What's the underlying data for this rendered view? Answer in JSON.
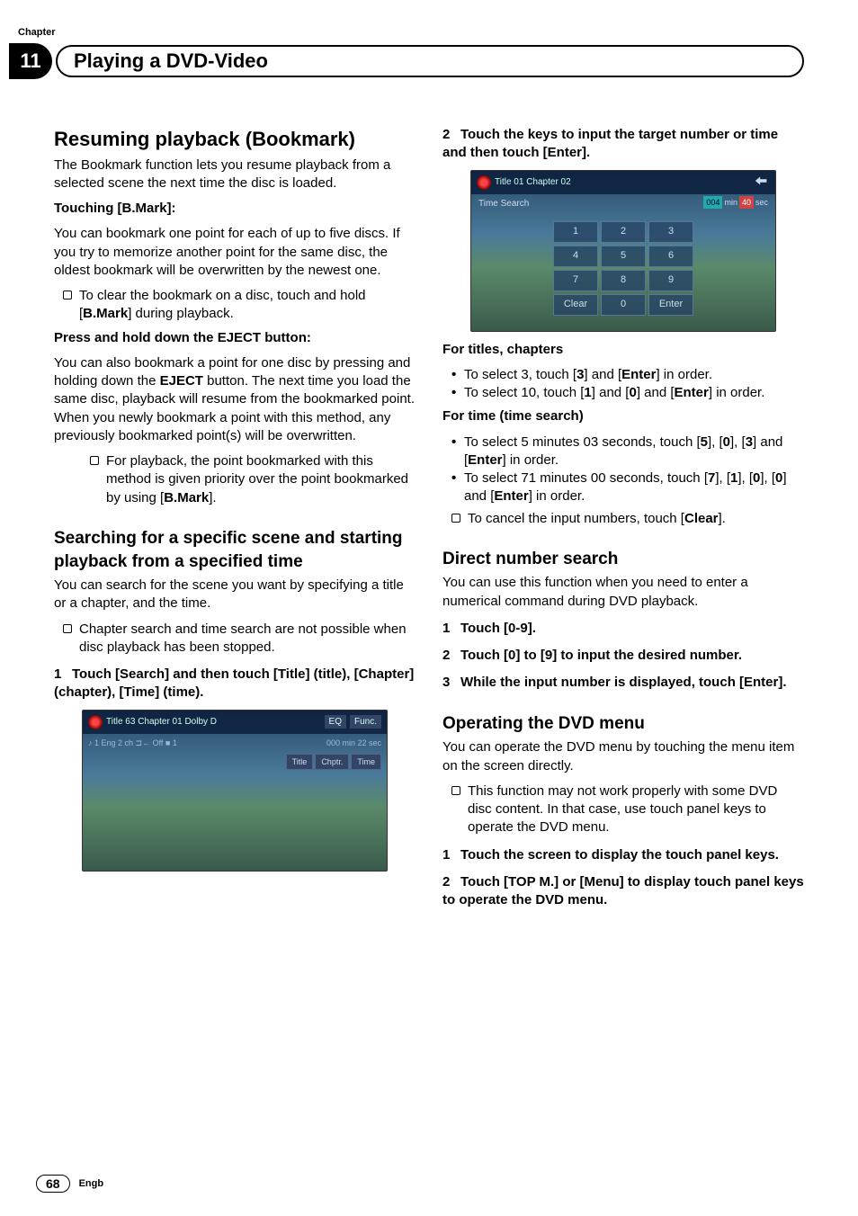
{
  "header": {
    "chapter_label": "Chapter",
    "chapter_number": "11",
    "title": "Playing a DVD-Video"
  },
  "left": {
    "h_resume": "Resuming playback (Bookmark)",
    "resume_intro": "The Bookmark function lets you resume playback from a selected scene the next time the disc is loaded.",
    "touching_bmark_label": "Touching [B.Mark]:",
    "touching_bmark_body": "You can bookmark one point for each of up to five discs. If you try to memorize another point for the same disc, the oldest bookmark will be overwritten by the newest one.",
    "touching_bmark_bullet_pre": "To clear the bookmark on a disc, touch and hold [",
    "touching_bmark_bullet_bold": "B.Mark",
    "touching_bmark_bullet_post": "] during playback.",
    "press_hold_label_pre": "Press and hold down the ",
    "press_hold_label_bold": "EJECT",
    "press_hold_label_post": " button:",
    "press_hold_body_pre": "You can also bookmark a point for one disc by pressing and holding down the ",
    "press_hold_body_bold": "EJECT",
    "press_hold_body_post": " button. The next time you load the same disc, playback will resume from the bookmarked point. When you newly bookmark a point with this method, any previously bookmarked point(s) will be overwritten.",
    "press_hold_bullet_pre": "For playback, the point bookmarked with this method is given priority over the point bookmarked by using [",
    "press_hold_bullet_bold": "B.Mark",
    "press_hold_bullet_post": "].",
    "h_search": "Searching for a specific scene and starting playback from a specified time",
    "search_intro": "You can search for the scene you want by specifying a title or a chapter, and the time.",
    "search_bullet": "Chapter search and time search are not possible when disc playback has been stopped.",
    "search_step1": "Touch [Search] and then touch [Title] (title), [Chapter] (chapter), [Time] (time).",
    "ss1": {
      "topline": "Title  63    Chapter 01        Dolby D",
      "line2_left": "♪ 1 Eng     2 ch   ⊐← Off      ■ 1",
      "eq": "EQ",
      "func": "Func.",
      "time": "000 min 22 sec",
      "btn_title": "Title",
      "btn_chptr": "Chptr.",
      "btn_time": "Time"
    }
  },
  "right": {
    "step2": "Touch the keys to input the target number or time and then touch [Enter].",
    "ss2": {
      "topline": "Title  01    Chapter 02",
      "time_search": "Time Search",
      "tb_min_val": "004",
      "tb_min_lbl": "min",
      "tb_sec_val": "40",
      "tb_sec_lbl": "sec",
      "k1": "1",
      "k2": "2",
      "k3": "3",
      "k4": "4",
      "k5": "5",
      "k6": "6",
      "k7": "7",
      "k8": "8",
      "k9": "9",
      "kclear": "Clear",
      "k0": "0",
      "kenter": "Enter"
    },
    "for_titles_label": "For titles, chapters",
    "titles_b1_pre": "To select 3, touch [",
    "titles_b1_m1": "3",
    "titles_b1_mid": "] and [",
    "titles_b1_m2": "Enter",
    "titles_b1_post": "] in order.",
    "titles_b2_pre": "To select 10, touch [",
    "titles_b2_m1": "1",
    "titles_b2_mid": "] and [",
    "titles_b2_m2": "0",
    "titles_b2_mid2": "] and [",
    "titles_b2_m3": "Enter",
    "titles_b2_post": "] in order.",
    "for_time_label": "For time (time search)",
    "time_b1_pre": "To select 5 minutes 03 seconds, touch [",
    "time_b1_m1": "5",
    "time_b1_mid": "], [",
    "time_b1_m2": "0",
    "time_b1_mid2": "], [",
    "time_b1_m3": "3",
    "time_b1_mid3": "] and [",
    "time_b1_m4": "Enter",
    "time_b1_post": "] in order.",
    "time_b2_pre": "To select 71 minutes 00 seconds, touch [",
    "time_b2_m1": "7",
    "time_b2_mid": "], [",
    "time_b2_m2": "1",
    "time_b2_mid2": "], [",
    "time_b2_m3": "0",
    "time_b2_mid3": "], [",
    "time_b2_m4": "0",
    "time_b2_mid4": "] and [",
    "time_b2_m5": "Enter",
    "time_b2_post": "] in order.",
    "time_cancel_pre": "To cancel the input numbers, touch [",
    "time_cancel_bold": "Clear",
    "time_cancel_post": "].",
    "h_direct": "Direct number search",
    "direct_intro": "You can use this function when you need to enter a numerical command during DVD playback.",
    "direct_s1": "Touch [0-9].",
    "direct_s2": "Touch [0] to [9] to input the desired number.",
    "direct_s3": "While the input number is displayed, touch [Enter].",
    "h_menu": "Operating the DVD menu",
    "menu_intro": "You can operate the DVD menu by touching the menu item on the screen directly.",
    "menu_bullet": "This function may not work properly with some DVD disc content. In that case, use touch panel keys to operate the DVD menu.",
    "menu_s1": "Touch the screen to display the touch panel keys.",
    "menu_s2": "Touch [TOP M.] or [Menu] to display touch panel keys to operate the DVD menu."
  },
  "footer": {
    "page": "68",
    "lang": "Engb"
  }
}
